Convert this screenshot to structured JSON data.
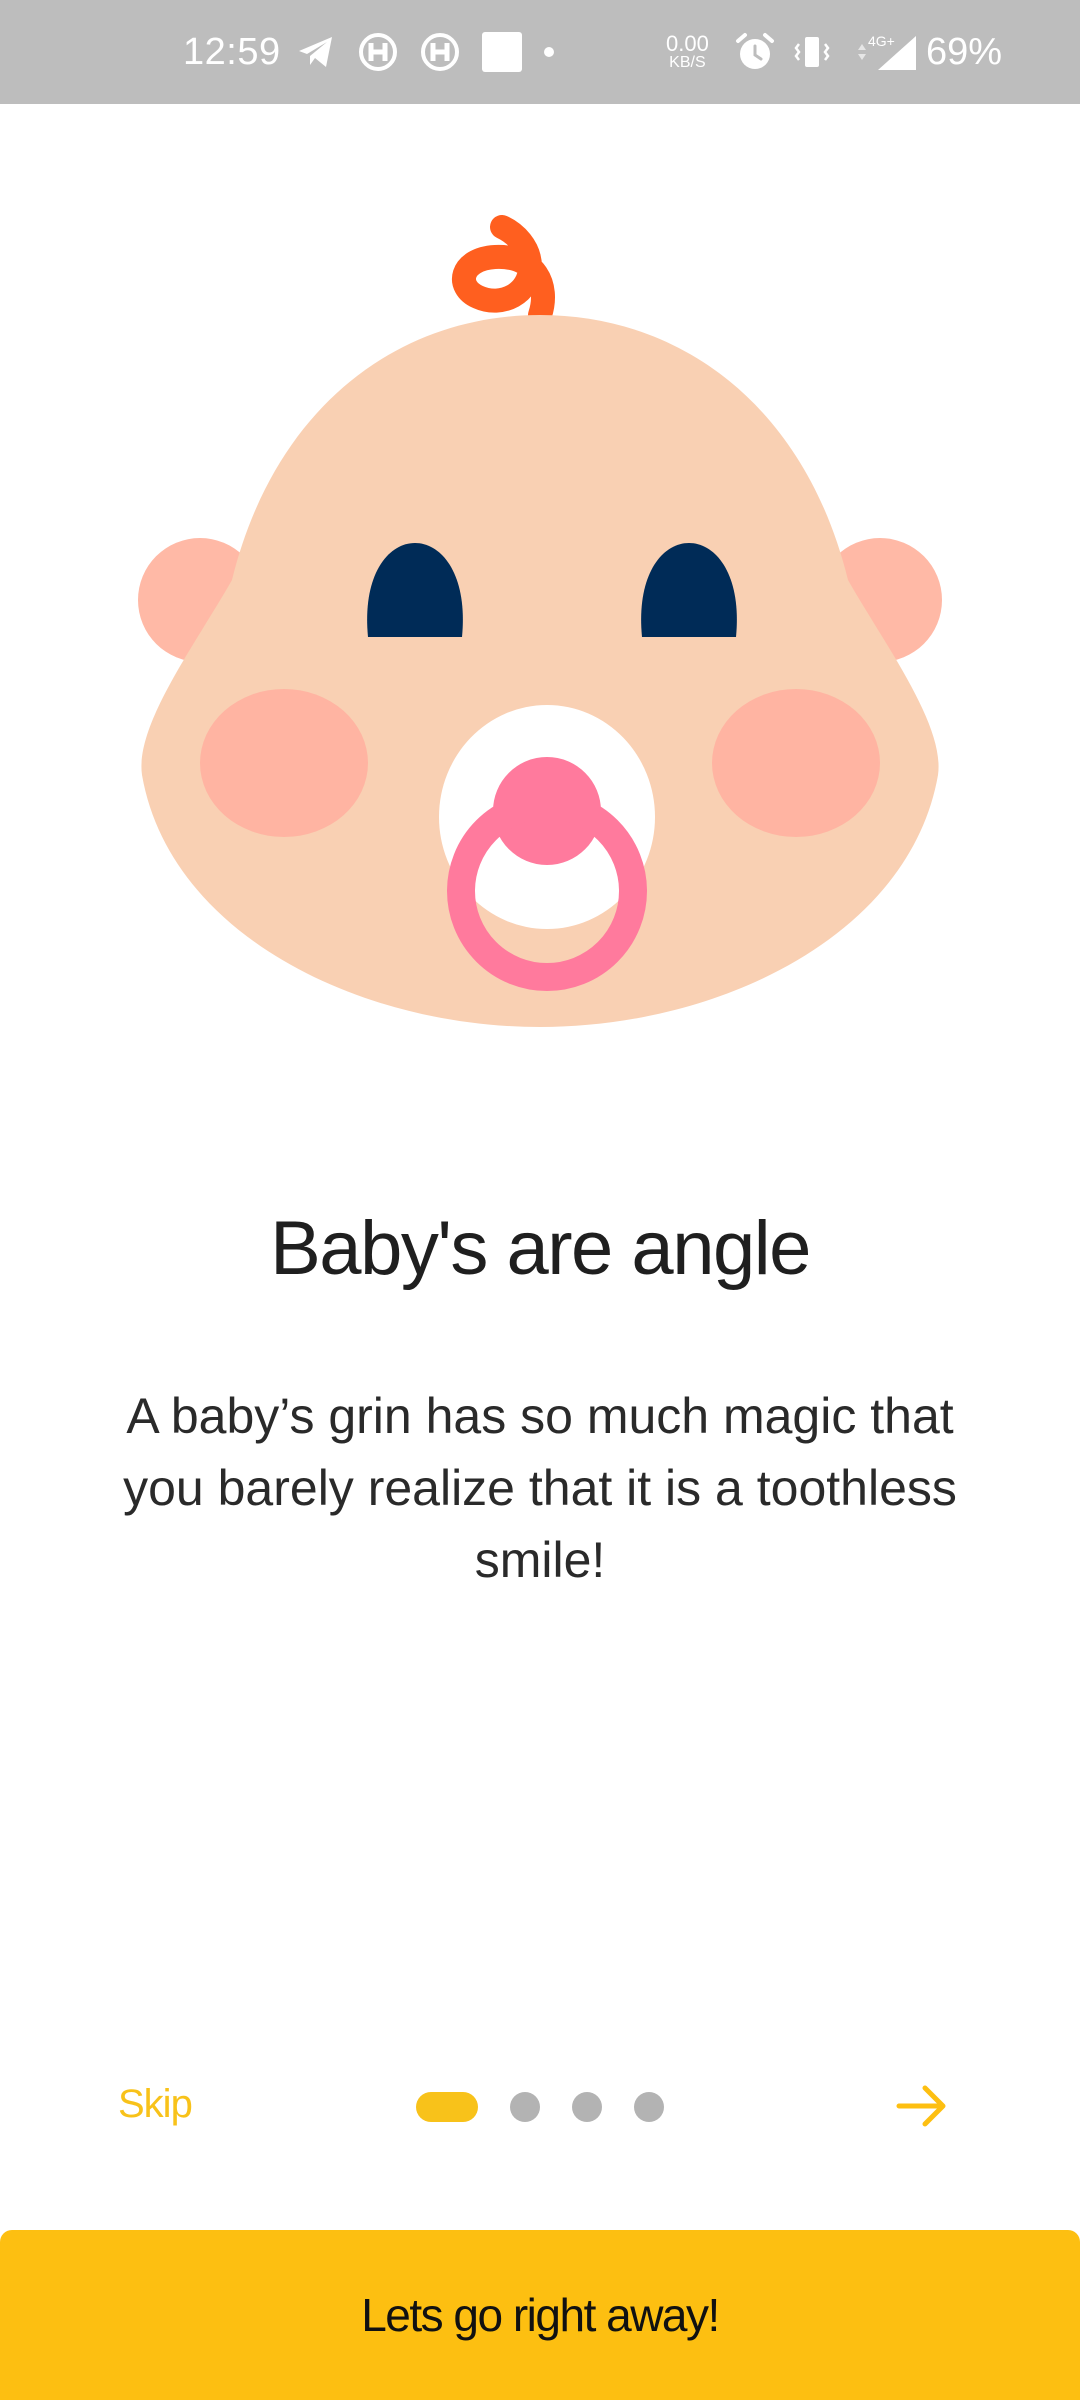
{
  "status_bar": {
    "time": "12:59",
    "net_speed_value": "0.00",
    "net_speed_unit": "KB/S",
    "network_type": "4G+",
    "battery": "69%",
    "icons_left": [
      "telegram-icon",
      "h-app-icon",
      "h-app-icon",
      "square-app-icon",
      "notification-dot-icon"
    ],
    "icons_right": [
      "alarm-icon",
      "vibrate-icon",
      "signal-icon"
    ]
  },
  "illustration": {
    "subject": "baby-face-with-pacifier",
    "colors": {
      "skin": "#f9d0b3",
      "ear": "#ffb9a6",
      "cheek": "#ffb4a2",
      "eye": "#002b57",
      "hair": "#ff5f1f",
      "pacifier": "#ff7a9d",
      "pacifier_shield": "#ffffff"
    }
  },
  "onboarding": {
    "title": "Baby's are angle",
    "description": "A baby’s grin has so much magic that you barely realize that it is a toothless smile!",
    "skip_label": "Skip",
    "page_count": 4,
    "active_page": 1,
    "next_icon": "arrow-right-icon",
    "cta_label": "Lets go right away!"
  },
  "colors": {
    "accent": "#fdbf11",
    "inactive_dot": "#b3b3b3",
    "status_bar": "#bdbdbd"
  }
}
